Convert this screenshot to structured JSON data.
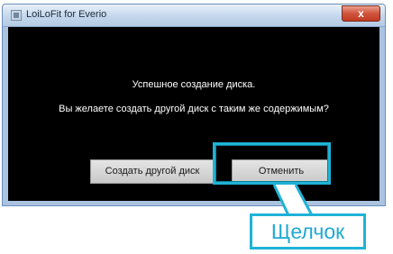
{
  "window": {
    "title": "LoiLoFit for Everio",
    "close_label": "x"
  },
  "dialog": {
    "message_line1": "Успешное создание диска.",
    "message_line2": "Вы желаете создать другой диск с таким же содержимым?",
    "create_another_label": "Создать другой диск",
    "cancel_label": "Отменить"
  },
  "annotation": {
    "callout_text": "Щелчок",
    "accent_color": "#1fb3d6"
  }
}
